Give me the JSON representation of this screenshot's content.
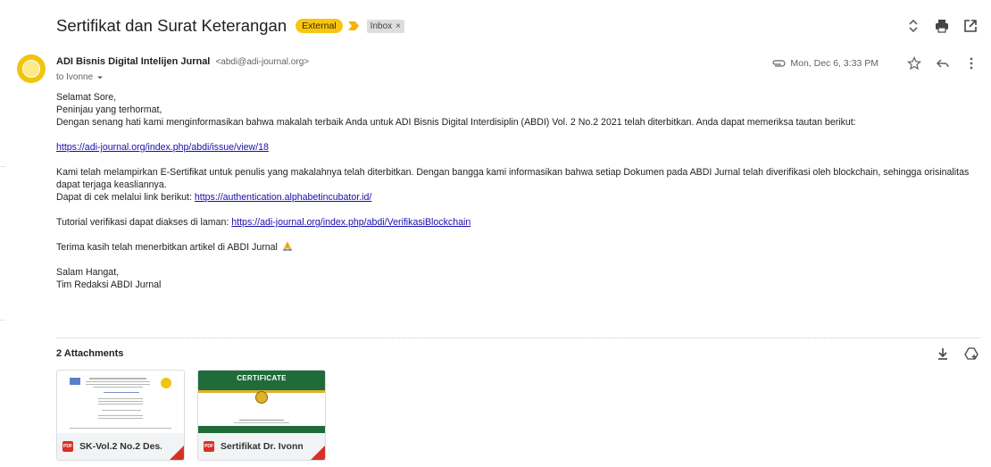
{
  "email": {
    "subject": "Sertifikat dan Surat Keterangan",
    "labels": {
      "external": "External",
      "inbox": "Inbox",
      "inbox_close": "×"
    },
    "sender": {
      "name": "ADI Bisnis Digital Intelijen Jurnal",
      "email": "<abdi@adi-journal.org>",
      "avatar_color": "#f1c40f"
    },
    "recipient": "to Ivonne",
    "date": "Mon, Dec 6, 3:33 PM",
    "body": {
      "greeting": "Selamat Sore,",
      "salutation": "Peninjau yang terhormat,",
      "intro": "Dengan senang hati kami menginformasikan bahwa makalah terbaik Anda untuk ADI Bisnis Digital Interdisiplin (ABDI) Vol. 2 No.2 2021 telah diterbitkan. Anda dapat memeriksa tautan berikut:",
      "issue_link": "https://adi-journal.org/index.php/abdi/issue/view/18",
      "cert_note": "Kami telah melampirkan E-Sertifikat untuk penulis yang makalahnya telah diterbitkan. Dengan bangga kami informasikan bahwa setiap Dokumen pada ABDI Jurnal telah diverifikasi oleh blockchain, sehingga orisinalitas dapat terjaga keasliannya.",
      "check_prefix": "Dapat di cek melalui link berikut: ",
      "check_link": "https://authentication.alphabetincubator.id/",
      "tutorial_prefix": "Tutorial verifikasi dapat diakses di laman: ",
      "tutorial_link": "https://adi-journal.org/index.php/abdi/VerifikasiBlockchain",
      "thanks": "Terima kasih telah menerbitkan artikel di ABDI Jurnal",
      "closing": "Salam Hangat,",
      "signature": "Tim Redaksi ABDI Jurnal"
    },
    "attachments": {
      "title": "2 Attachments",
      "files": [
        {
          "name": "SK-Vol.2 No.2 Des...",
          "type": "PDF"
        },
        {
          "name": "Sertifikat Dr. Ivonn...",
          "type": "PDF",
          "thumb_title": "CERTIFICATE"
        }
      ]
    }
  },
  "colors": {
    "external_badge": "#f9c513",
    "link": "#1a0dab",
    "pdf": "#d93025",
    "cert_green": "#1f6b3a",
    "cert_gold": "#e0b12a"
  },
  "icons": [
    "expand-collapse-icon",
    "print-icon",
    "open-in-new-icon",
    "attachment-clip-icon",
    "star-icon",
    "reply-icon",
    "more-vert-icon",
    "download-icon",
    "add-to-drive-icon",
    "folded-hands-emoji-icon",
    "pdf-icon",
    "dropdown-caret-icon",
    "importance-marker-icon"
  ]
}
